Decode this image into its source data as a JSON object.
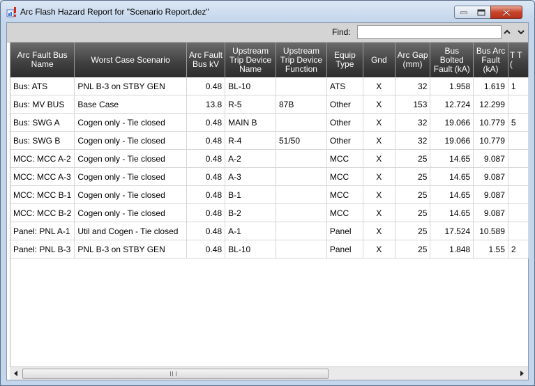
{
  "window": {
    "title": "Arc Flash Hazard Report for \"Scenario Report.dez\""
  },
  "findbar": {
    "label": "Find:",
    "value": "",
    "placeholder": ""
  },
  "table": {
    "columns": [
      "Arc Fault Bus Name",
      "Worst Case Scenario",
      "Arc Fault Bus kV",
      "Upstream Trip Device Name",
      "Upstream Trip Device Function",
      "Equip Type",
      "Gnd",
      "Arc Gap (mm)",
      "Bus Bolted Fault (kA)",
      "Bus Arc Fault (kA)",
      "T T ("
    ],
    "rows": [
      [
        "Bus: ATS",
        "PNL B-3 on STBY GEN",
        "0.48",
        "BL-10",
        "",
        "ATS",
        "X",
        "32",
        "1.958",
        "1.619",
        "1"
      ],
      [
        "Bus: MV BUS",
        "Base Case",
        "13.8",
        "R-5",
        "87B",
        "Other",
        "X",
        "153",
        "12.724",
        "12.299",
        ""
      ],
      [
        "Bus: SWG A",
        "Cogen only - Tie closed",
        "0.48",
        "MAIN B",
        "",
        "Other",
        "X",
        "32",
        "19.066",
        "10.779",
        "5"
      ],
      [
        "Bus: SWG B",
        "Cogen only - Tie closed",
        "0.48",
        "R-4",
        "51/50",
        "Other",
        "X",
        "32",
        "19.066",
        "10.779",
        ""
      ],
      [
        "MCC: MCC A-2",
        "Cogen only - Tie closed",
        "0.48",
        "A-2",
        "",
        "MCC",
        "X",
        "25",
        "14.65",
        "9.087",
        ""
      ],
      [
        "MCC: MCC A-3",
        "Cogen only - Tie closed",
        "0.48",
        "A-3",
        "",
        "MCC",
        "X",
        "25",
        "14.65",
        "9.087",
        ""
      ],
      [
        "MCC: MCC B-1",
        "Cogen only - Tie closed",
        "0.48",
        "B-1",
        "",
        "MCC",
        "X",
        "25",
        "14.65",
        "9.087",
        ""
      ],
      [
        "MCC: MCC B-2",
        "Cogen only - Tie closed",
        "0.48",
        "B-2",
        "",
        "MCC",
        "X",
        "25",
        "14.65",
        "9.087",
        ""
      ],
      [
        "Panel: PNL A-1",
        "Util and Cogen - Tie closed",
        "0.48",
        "A-1",
        "",
        "Panel",
        "X",
        "25",
        "17.524",
        "10.589",
        ""
      ],
      [
        "Panel: PNL B-3",
        "PNL B-3 on STBY GEN",
        "0.48",
        "BL-10",
        "",
        "Panel",
        "X",
        "25",
        "1.848",
        "1.55",
        "2"
      ]
    ]
  },
  "icons": {
    "app": "report-warning-icon",
    "minimize": "minimize-icon",
    "maximize": "maximize-icon",
    "close": "close-icon",
    "find_prev": "chevron-up-icon",
    "find_next": "chevron-down-icon",
    "scroll_left": "arrow-left-icon",
    "scroll_right": "arrow-right-icon"
  },
  "colors": {
    "header_bg": "#3f3f3f",
    "close_button": "#c7442c",
    "title_bg": "#c4d6ec"
  }
}
